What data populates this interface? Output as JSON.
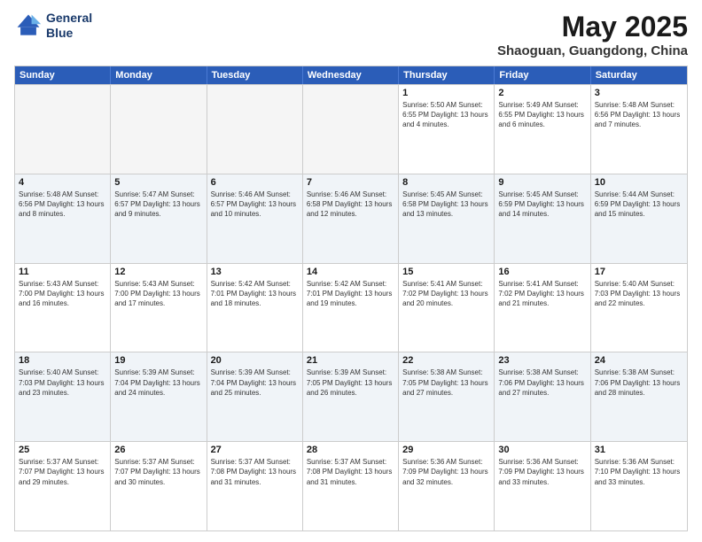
{
  "logo": {
    "line1": "General",
    "line2": "Blue"
  },
  "title": "May 2025",
  "subtitle": "Shaoguan, Guangdong, China",
  "days_of_week": [
    "Sunday",
    "Monday",
    "Tuesday",
    "Wednesday",
    "Thursday",
    "Friday",
    "Saturday"
  ],
  "weeks": [
    [
      {
        "day": "",
        "info": ""
      },
      {
        "day": "",
        "info": ""
      },
      {
        "day": "",
        "info": ""
      },
      {
        "day": "",
        "info": ""
      },
      {
        "day": "1",
        "info": "Sunrise: 5:50 AM\nSunset: 6:55 PM\nDaylight: 13 hours\nand 4 minutes."
      },
      {
        "day": "2",
        "info": "Sunrise: 5:49 AM\nSunset: 6:55 PM\nDaylight: 13 hours\nand 6 minutes."
      },
      {
        "day": "3",
        "info": "Sunrise: 5:48 AM\nSunset: 6:56 PM\nDaylight: 13 hours\nand 7 minutes."
      }
    ],
    [
      {
        "day": "4",
        "info": "Sunrise: 5:48 AM\nSunset: 6:56 PM\nDaylight: 13 hours\nand 8 minutes."
      },
      {
        "day": "5",
        "info": "Sunrise: 5:47 AM\nSunset: 6:57 PM\nDaylight: 13 hours\nand 9 minutes."
      },
      {
        "day": "6",
        "info": "Sunrise: 5:46 AM\nSunset: 6:57 PM\nDaylight: 13 hours\nand 10 minutes."
      },
      {
        "day": "7",
        "info": "Sunrise: 5:46 AM\nSunset: 6:58 PM\nDaylight: 13 hours\nand 12 minutes."
      },
      {
        "day": "8",
        "info": "Sunrise: 5:45 AM\nSunset: 6:58 PM\nDaylight: 13 hours\nand 13 minutes."
      },
      {
        "day": "9",
        "info": "Sunrise: 5:45 AM\nSunset: 6:59 PM\nDaylight: 13 hours\nand 14 minutes."
      },
      {
        "day": "10",
        "info": "Sunrise: 5:44 AM\nSunset: 6:59 PM\nDaylight: 13 hours\nand 15 minutes."
      }
    ],
    [
      {
        "day": "11",
        "info": "Sunrise: 5:43 AM\nSunset: 7:00 PM\nDaylight: 13 hours\nand 16 minutes."
      },
      {
        "day": "12",
        "info": "Sunrise: 5:43 AM\nSunset: 7:00 PM\nDaylight: 13 hours\nand 17 minutes."
      },
      {
        "day": "13",
        "info": "Sunrise: 5:42 AM\nSunset: 7:01 PM\nDaylight: 13 hours\nand 18 minutes."
      },
      {
        "day": "14",
        "info": "Sunrise: 5:42 AM\nSunset: 7:01 PM\nDaylight: 13 hours\nand 19 minutes."
      },
      {
        "day": "15",
        "info": "Sunrise: 5:41 AM\nSunset: 7:02 PM\nDaylight: 13 hours\nand 20 minutes."
      },
      {
        "day": "16",
        "info": "Sunrise: 5:41 AM\nSunset: 7:02 PM\nDaylight: 13 hours\nand 21 minutes."
      },
      {
        "day": "17",
        "info": "Sunrise: 5:40 AM\nSunset: 7:03 PM\nDaylight: 13 hours\nand 22 minutes."
      }
    ],
    [
      {
        "day": "18",
        "info": "Sunrise: 5:40 AM\nSunset: 7:03 PM\nDaylight: 13 hours\nand 23 minutes."
      },
      {
        "day": "19",
        "info": "Sunrise: 5:39 AM\nSunset: 7:04 PM\nDaylight: 13 hours\nand 24 minutes."
      },
      {
        "day": "20",
        "info": "Sunrise: 5:39 AM\nSunset: 7:04 PM\nDaylight: 13 hours\nand 25 minutes."
      },
      {
        "day": "21",
        "info": "Sunrise: 5:39 AM\nSunset: 7:05 PM\nDaylight: 13 hours\nand 26 minutes."
      },
      {
        "day": "22",
        "info": "Sunrise: 5:38 AM\nSunset: 7:05 PM\nDaylight: 13 hours\nand 27 minutes."
      },
      {
        "day": "23",
        "info": "Sunrise: 5:38 AM\nSunset: 7:06 PM\nDaylight: 13 hours\nand 27 minutes."
      },
      {
        "day": "24",
        "info": "Sunrise: 5:38 AM\nSunset: 7:06 PM\nDaylight: 13 hours\nand 28 minutes."
      }
    ],
    [
      {
        "day": "25",
        "info": "Sunrise: 5:37 AM\nSunset: 7:07 PM\nDaylight: 13 hours\nand 29 minutes."
      },
      {
        "day": "26",
        "info": "Sunrise: 5:37 AM\nSunset: 7:07 PM\nDaylight: 13 hours\nand 30 minutes."
      },
      {
        "day": "27",
        "info": "Sunrise: 5:37 AM\nSunset: 7:08 PM\nDaylight: 13 hours\nand 31 minutes."
      },
      {
        "day": "28",
        "info": "Sunrise: 5:37 AM\nSunset: 7:08 PM\nDaylight: 13 hours\nand 31 minutes."
      },
      {
        "day": "29",
        "info": "Sunrise: 5:36 AM\nSunset: 7:09 PM\nDaylight: 13 hours\nand 32 minutes."
      },
      {
        "day": "30",
        "info": "Sunrise: 5:36 AM\nSunset: 7:09 PM\nDaylight: 13 hours\nand 33 minutes."
      },
      {
        "day": "31",
        "info": "Sunrise: 5:36 AM\nSunset: 7:10 PM\nDaylight: 13 hours\nand 33 minutes."
      }
    ]
  ]
}
